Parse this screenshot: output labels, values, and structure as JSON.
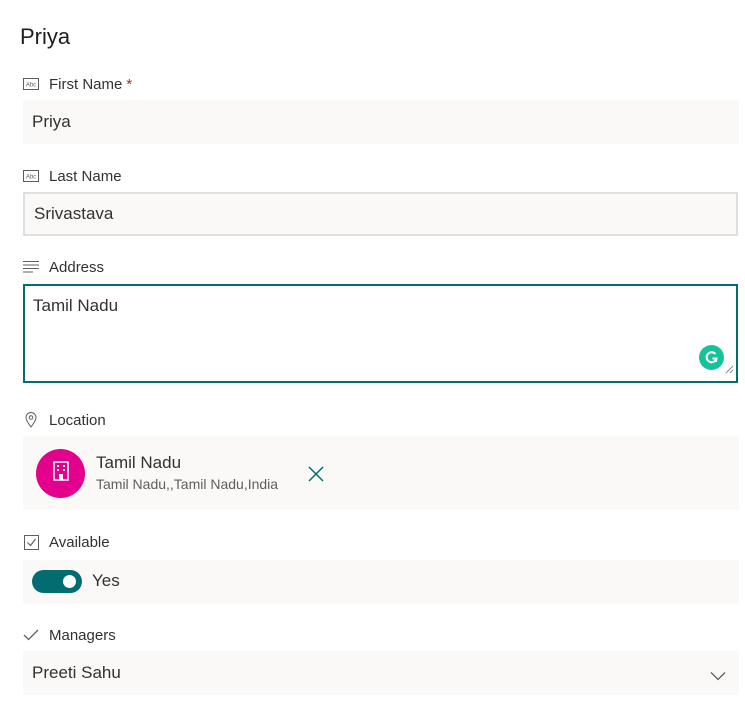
{
  "form": {
    "title": "Priya",
    "accent_color": "#036c70",
    "first_name": {
      "label": "First Name",
      "required_marker": "*",
      "value": "Priya",
      "icon": "text-field-icon"
    },
    "last_name": {
      "label": "Last Name",
      "value": "Srivastava",
      "icon": "text-field-icon"
    },
    "address": {
      "label": "Address",
      "value": "Tamil Nadu",
      "icon": "multiline-text-icon"
    },
    "location": {
      "label": "Location",
      "icon": "location-pin-icon",
      "name": "Tamil Nadu",
      "address": "Tamil Nadu,,Tamil Nadu,India",
      "avatar_color": "#e3008c",
      "avatar_icon": "building-icon",
      "remove_icon": "close-icon"
    },
    "available": {
      "label": "Available",
      "icon": "checkbox-icon",
      "toggle_on": true,
      "toggle_text": "Yes"
    },
    "managers": {
      "label": "Managers",
      "icon": "checkmark-icon",
      "value": "Preeti Sahu",
      "dropdown_icon": "chevron-down-icon"
    }
  }
}
